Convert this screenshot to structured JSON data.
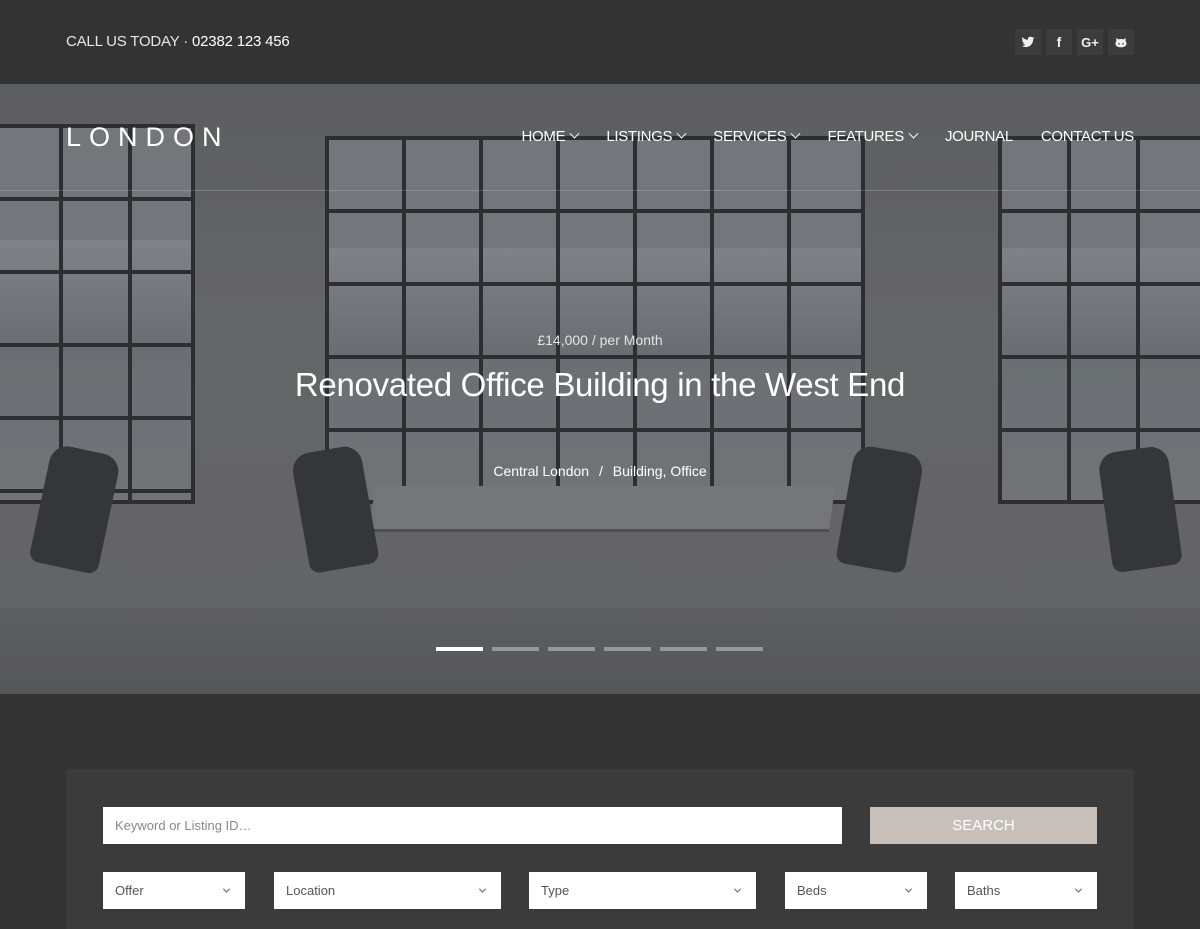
{
  "topbar": {
    "call_label": "CALL US TODAY ·",
    "phone": "02382 123 456",
    "socials": [
      {
        "name": "twitter-icon",
        "glyph": "twitter"
      },
      {
        "name": "facebook-icon",
        "glyph": "f"
      },
      {
        "name": "google-plus-icon",
        "glyph": "G+"
      },
      {
        "name": "github-icon",
        "glyph": "github"
      }
    ]
  },
  "header": {
    "logo": "LONDON",
    "nav": [
      {
        "label": "HOME",
        "dropdown": true
      },
      {
        "label": "LISTINGS",
        "dropdown": true
      },
      {
        "label": "SERVICES",
        "dropdown": true
      },
      {
        "label": "FEATURES",
        "dropdown": true
      },
      {
        "label": "JOURNAL",
        "dropdown": false
      },
      {
        "label": "CONTACT US",
        "dropdown": false
      }
    ]
  },
  "hero": {
    "price": "£14,000 / per Month",
    "title": "Renovated Office Building in the West End",
    "location": "Central London",
    "separator": "/",
    "types": "Building, Office",
    "slides_total": 6,
    "active_slide": 1
  },
  "search": {
    "keyword_placeholder": "Keyword or Listing ID…",
    "keyword_value": "",
    "button_label": "SEARCH",
    "selects": [
      {
        "label": "Offer"
      },
      {
        "label": "Location"
      },
      {
        "label": "Type"
      },
      {
        "label": "Beds"
      },
      {
        "label": "Baths"
      }
    ]
  },
  "colors": {
    "background": "#333333",
    "panel": "#3b3b3b",
    "search_button": "#c7bfb9",
    "text_light": "#ffffff"
  }
}
